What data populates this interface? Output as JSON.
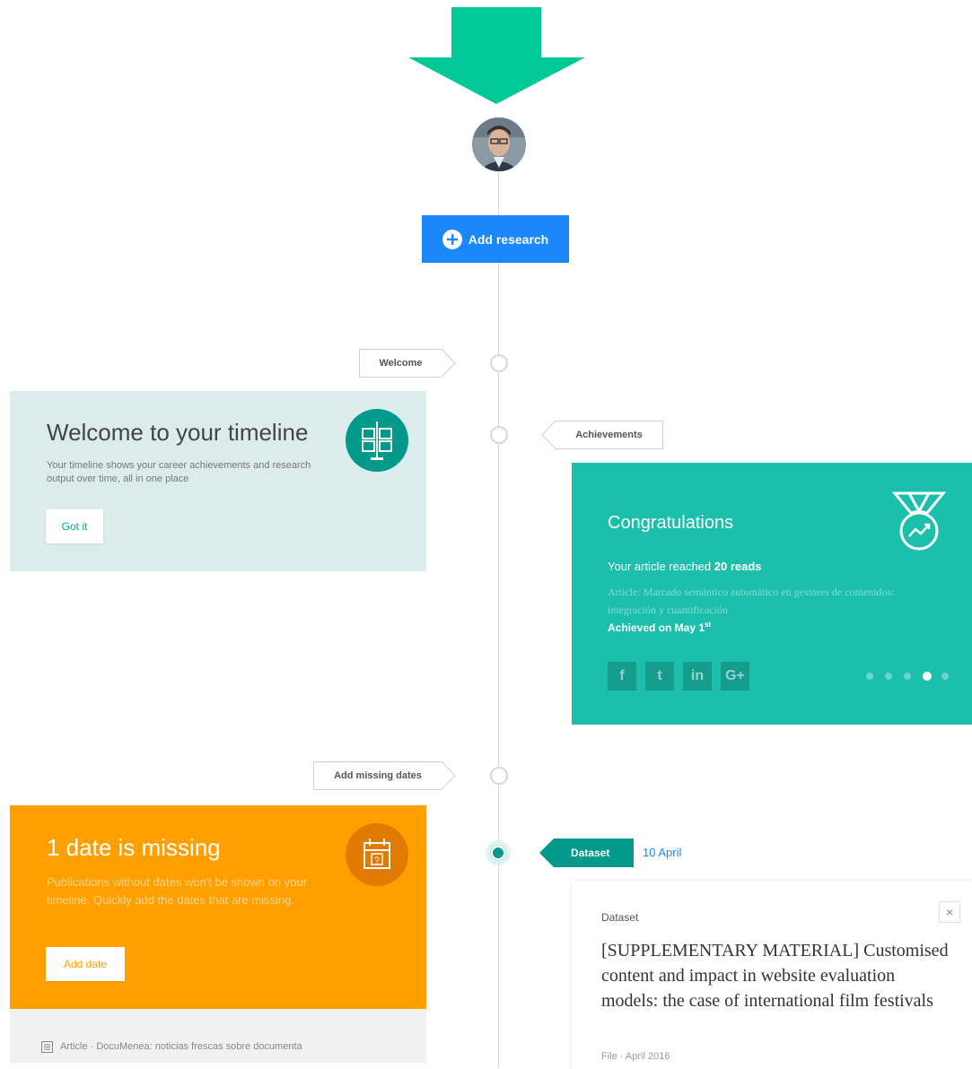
{
  "add_research": {
    "label": "Add research"
  },
  "labels": {
    "welcome": "Welcome",
    "achievements": "Achievements",
    "add_missing_dates": "Add missing dates",
    "dataset_tag": "Dataset",
    "dataset_date": "10 April"
  },
  "welcome_card": {
    "title": "Welcome to your timeline",
    "body": "Your timeline shows your career achievements and research output over time, all in one place",
    "button": "Got it"
  },
  "congrats_card": {
    "title": "Congratulations",
    "headline_prefix": "Your article reached ",
    "headline_bold": "20 reads",
    "article_line": "Article: Marcado semántico automático en gestores de contenidos: integración y cuantificación",
    "achieved": "Achieved on May 1",
    "achieved_sup": "st",
    "social": [
      "f",
      "t",
      "in",
      "G+"
    ],
    "carousel": {
      "count": 5,
      "active": 4
    }
  },
  "missing_card": {
    "title": "1 date is missing",
    "body": "Publications without dates won't be shown on your timeline. Quickly add the dates that are missing.",
    "button": "Add date",
    "footer": "Article · DocuMenea: noticias frescas sobre documenta"
  },
  "dataset_card": {
    "type": "Dataset",
    "title": "[SUPPLEMENTARY MATERIAL] Customised content and impact in website evaluation models: the case of international film festivals",
    "meta": "File · April 2016",
    "close": "×"
  },
  "icons": [
    "arrow-down-icon",
    "plus-circle-icon",
    "signpost-icon",
    "medal-icon",
    "calendar-icon",
    "article-icon",
    "close-icon"
  ],
  "colors": {
    "teal": "#1cbfab",
    "teal_dark": "#00998a",
    "blue": "#1a87fb",
    "orange": "#ff9f00",
    "welcome_bg": "#dcecec",
    "arrow": "#00c896"
  }
}
